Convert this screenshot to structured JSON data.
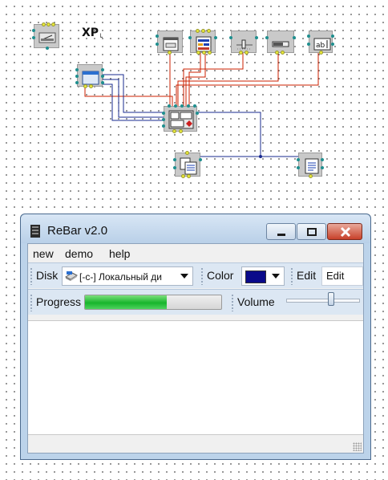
{
  "schema": {
    "xp_label": "XP",
    "xp_sub": "└",
    "nodes": [
      {
        "id": "menu-node",
        "icon": "menu-component-icon"
      },
      {
        "id": "xp-manifest",
        "icon": "xp-manifest-icon"
      },
      {
        "id": "window-node",
        "icon": "window-component-icon"
      },
      {
        "id": "form-node",
        "icon": "form-component-icon"
      },
      {
        "id": "disk-combo-node",
        "icon": "drive-combo-icon"
      },
      {
        "id": "trackbar-node",
        "icon": "trackbar-component-icon"
      },
      {
        "id": "progressbar-node",
        "icon": "progressbar-component-icon"
      },
      {
        "id": "edit-node",
        "icon": "edit-component-icon"
      },
      {
        "id": "rebar-node",
        "icon": "rebar-component-icon"
      },
      {
        "id": "memo-node",
        "icon": "memo-component-icon"
      },
      {
        "id": "statusbar-node",
        "icon": "statusbar-component-icon"
      }
    ],
    "colors": {
      "wire_red": "#cc2200",
      "wire_blue": "#1a2b8f",
      "node_bg": "#c9c9c9"
    }
  },
  "window": {
    "title": "ReBar v2.0",
    "icon": "app-icon",
    "buttons": {
      "minimize": "minimize-icon",
      "maximize": "maximize-icon",
      "close": "close-icon"
    }
  },
  "menu": {
    "items": [
      "new",
      "demo",
      "help"
    ]
  },
  "bands": {
    "disk": {
      "label": "Disk",
      "value": "[-c-]  Локальный ди",
      "icon": "drive-icon"
    },
    "color": {
      "label": "Color",
      "value_color": "#0a0a8a"
    },
    "edit": {
      "label": "Edit",
      "value": "Edit"
    },
    "progress": {
      "label": "Progress",
      "fraction": 0.6
    },
    "volume": {
      "label": "Volume",
      "fraction": 0.62
    }
  },
  "colors": {
    "accent_green": "#17b52c",
    "window_frame": "#bcd3ea",
    "close_red": "#c8412a"
  }
}
